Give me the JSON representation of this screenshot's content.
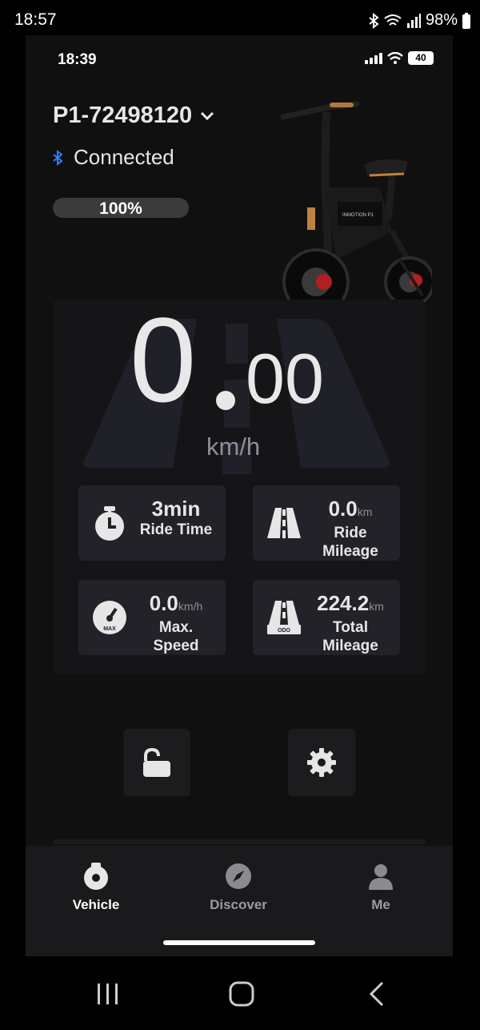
{
  "android_status": {
    "time": "18:57",
    "battery": "98%"
  },
  "ios_status": {
    "time": "18:39",
    "battery": "40"
  },
  "device": {
    "name": "P1-72498120",
    "connection": "Connected",
    "battery_level": "100%",
    "battery_fraction": 1.0
  },
  "speed": {
    "integer": "0",
    "decimal": "00",
    "unit": "km/h"
  },
  "stats": {
    "ride_time": {
      "value": "3min",
      "label": "Ride Time",
      "icon": "stopwatch-icon"
    },
    "ride_mileage": {
      "value": "0.0",
      "unit": "km",
      "label1": "Ride",
      "label2": "Mileage",
      "icon": "road-icon"
    },
    "max_speed": {
      "value": "0.0",
      "unit": "km/h",
      "label1": "Max.",
      "label2": "Speed",
      "icon": "speedometer-icon",
      "icon_text": "MAX"
    },
    "total_mileage": {
      "value": "224.2",
      "unit": "km",
      "label1": "Total",
      "label2": "Mileage",
      "icon": "odometer-road-icon",
      "icon_text": "ODO"
    }
  },
  "controls": {
    "lock_icon": "unlock-icon",
    "settings_icon": "gear-icon"
  },
  "nav": {
    "items": [
      {
        "label": "Vehicle",
        "icon": "scooter-wheel-icon",
        "active": true
      },
      {
        "label": "Discover",
        "icon": "compass-icon",
        "active": false
      },
      {
        "label": "Me",
        "icon": "person-icon",
        "active": false
      }
    ]
  },
  "colors": {
    "background": "#101010",
    "panel": "#151518",
    "card": "#222228",
    "bluetooth": "#2f7ff7",
    "muted": "#8f8f95"
  }
}
